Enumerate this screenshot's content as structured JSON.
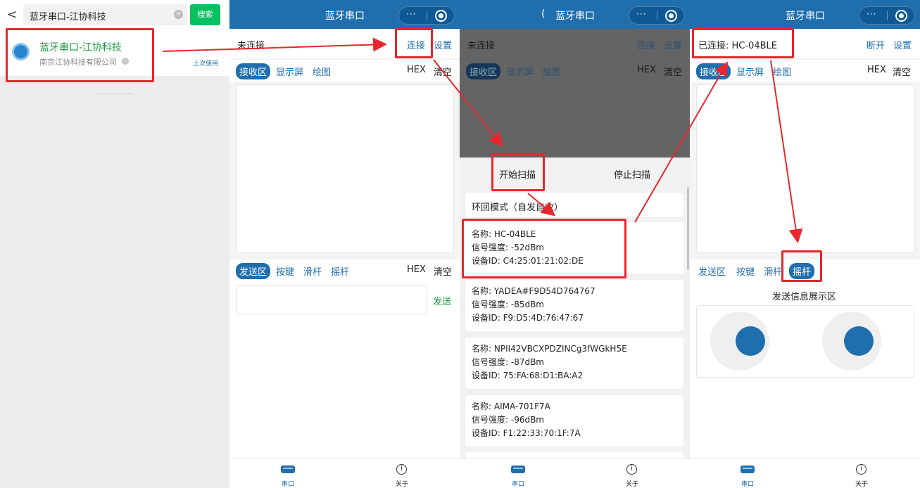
{
  "search": {
    "back_icon": "chevron-left-icon",
    "query": "蓝牙串口-江协科技",
    "clear_icon": "clear-icon",
    "button": "搜索",
    "result": {
      "title": "蓝牙串口-江协科技",
      "company": "南京江协科技有限公司",
      "badge": "上次使用"
    }
  },
  "app": {
    "title": "蓝牙串口",
    "capsule_menu": "···",
    "disconnected": "未连接",
    "connect": "连接",
    "settings": "设置",
    "disconnect": "断开",
    "connected_label": "已连接: HC-04BLE",
    "tabs": {
      "receive": "接收区",
      "display": "显示屏",
      "plot": "绘图"
    },
    "hex": "HEX",
    "clear": "清空",
    "send_tabs": {
      "send": "发送区",
      "keys": "按键",
      "slider": "滑杆",
      "joystick": "摇杆"
    },
    "send_button": "发送",
    "send_info": "发送信息展示区",
    "bottom_tabs": {
      "serial": "串口",
      "about": "关于"
    }
  },
  "scan": {
    "start": "开始扫描",
    "stop": "停止扫描",
    "loopback": "环回模式（自发自收）",
    "devices": [
      {
        "name": "名称: HC-04BLE",
        "rssi": "信号强度: -52dBm",
        "id": "设备ID: C4:25:01:21:02:DE"
      },
      {
        "name": "名称: YADEA#F9D54D764767",
        "rssi": "信号强度: -85dBm",
        "id": "设备ID: F9:D5:4D:76:47:67"
      },
      {
        "name": "名称: NPII42VBCXPDZINCg3fWGkH5E",
        "rssi": "信号强度: -87dBm",
        "id": "设备ID: 75:FA:68:D1:BA:A2"
      },
      {
        "name": "名称: AIMA-701F7A",
        "rssi": "信号强度: -96dBm",
        "id": "设备ID: F1:22:33:70:1F:7A"
      }
    ]
  },
  "colors": {
    "accent": "#1f6eae",
    "highlight": "#e8262d",
    "search_green": "#07c160"
  }
}
